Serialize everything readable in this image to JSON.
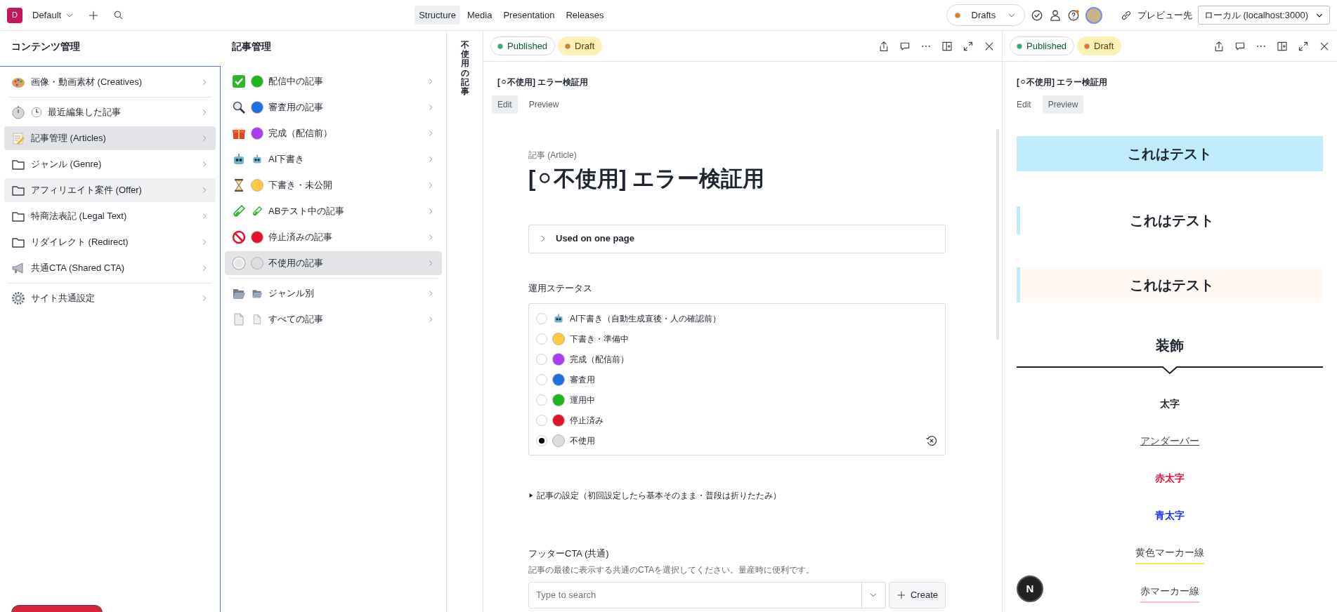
{
  "topbar": {
    "workspace_initial": "D",
    "workspace": "Default",
    "nav": [
      {
        "label": "Structure",
        "selected": true
      },
      {
        "label": "Media",
        "selected": false
      },
      {
        "label": "Presentation",
        "selected": false
      },
      {
        "label": "Releases",
        "selected": false
      }
    ],
    "perspective": "Drafts",
    "preview_label": "プレビュー先",
    "preview_target": "ローカル (localhost:3000)"
  },
  "pane_content": {
    "title": "コンテンツ管理",
    "groups": [
      [
        {
          "label": "画像・動画素材 (Creatives)",
          "selected": false,
          "hovered": false
        }
      ],
      [
        {
          "label": "最近編集した記事",
          "selected": false,
          "hovered": false
        },
        {
          "label": "記事管理 (Articles)",
          "selected": true,
          "hovered": false
        },
        {
          "label": "ジャンル (Genre)",
          "selected": false,
          "hovered": false
        },
        {
          "label": "アフィリエイト案件 (Offer)",
          "selected": false,
          "hovered": true
        },
        {
          "label": "特商法表記 (Legal Text)",
          "selected": false,
          "hovered": false
        },
        {
          "label": "リダイレクト (Redirect)",
          "selected": false,
          "hovered": false
        },
        {
          "label": "共通CTA (Shared CTA)",
          "selected": false,
          "hovered": false
        }
      ],
      [
        {
          "label": "サイト共通設定",
          "selected": false,
          "hovered": false
        }
      ]
    ]
  },
  "pane_articles": {
    "title": "記事管理",
    "groups": [
      [
        {
          "color": "#1db41d",
          "label": "配信中の記事",
          "selected": false
        },
        {
          "color": "#1f6fe0",
          "label": "審査用の記事",
          "selected": false
        },
        {
          "color": "#a53ff0",
          "label": "完成（配信前）",
          "selected": false
        },
        {
          "label": "AI下書き",
          "selected": false
        },
        {
          "color": "#ffc83d",
          "label": "下書き・未公開",
          "selected": false
        },
        {
          "label": "ABテスト中の記事",
          "selected": false
        },
        {
          "color": "#e3122c",
          "label": "停止済みの記事",
          "selected": false
        },
        {
          "color": "#dddddd",
          "label": "不使用の記事",
          "selected": true
        }
      ],
      [
        {
          "label": "ジャンル別",
          "selected": false
        },
        {
          "label": "すべての記事",
          "selected": false
        }
      ]
    ]
  },
  "collapsed_pane": {
    "title": "不使用の記事"
  },
  "editor": {
    "published": "Published",
    "draft": "Draft",
    "doc_title": "[⚪不使用] エラー検証用",
    "tabs": [
      {
        "label": "Edit",
        "selected": true
      },
      {
        "label": "Preview",
        "selected": false
      }
    ],
    "type_label": "記事 (Article)",
    "heading": "[⚪不使用] エラー検証用",
    "usage": "Used on one page",
    "status_label": "運用ステータス",
    "status_options": [
      {
        "label": "AI下書き（自動生成直後・人の確認前）",
        "checked": false
      },
      {
        "color": "#ffc83d",
        "label": "下書き・準備中",
        "checked": false
      },
      {
        "color": "#a53ff0",
        "label": "完成（配信前）",
        "checked": false
      },
      {
        "color": "#1f6fe0",
        "label": "審査用",
        "checked": false
      },
      {
        "color": "#1db41d",
        "label": "運用中",
        "checked": false
      },
      {
        "color": "#e3122c",
        "label": "停止済み",
        "checked": false
      },
      {
        "color": "#dddddd",
        "label": "不使用",
        "checked": true
      }
    ],
    "settings_section": "記事の設定（初回設定したら基本そのまま・普段は折りたたみ）",
    "cta_label": "フッターCTA (共通)",
    "cta_description": "記事の最後に表示する共通のCTAを選択してください。量産時に便利です。",
    "cta_placeholder": "Type to search",
    "create": "Create"
  },
  "preview": {
    "published": "Published",
    "draft": "Draft",
    "doc_title": "[⚪不使用] エラー検証用",
    "tabs": [
      {
        "label": "Edit",
        "selected": false
      },
      {
        "label": "Preview",
        "selected": true
      }
    ],
    "blocks": [
      {
        "kind": "banner",
        "text": "これはテスト"
      },
      {
        "kind": "bar",
        "text": "これはテスト"
      },
      {
        "kind": "bartinted",
        "text": "これはテスト"
      },
      {
        "kind": "notched",
        "text": "装飾"
      },
      {
        "kind": "bold",
        "text": "太字"
      },
      {
        "kind": "underline",
        "text": "アンダーバー"
      },
      {
        "kind": "bold",
        "color": "#e8103c",
        "text": "赤太字"
      },
      {
        "kind": "bold",
        "color": "#2233ee",
        "text": "青太字"
      },
      {
        "kind": "marker",
        "color": "#ffe066",
        "text": "黄色マーカー線"
      },
      {
        "kind": "marker",
        "color": "#ffb8c6",
        "text": "赤マーカー線"
      }
    ],
    "dev_badge": "N"
  }
}
